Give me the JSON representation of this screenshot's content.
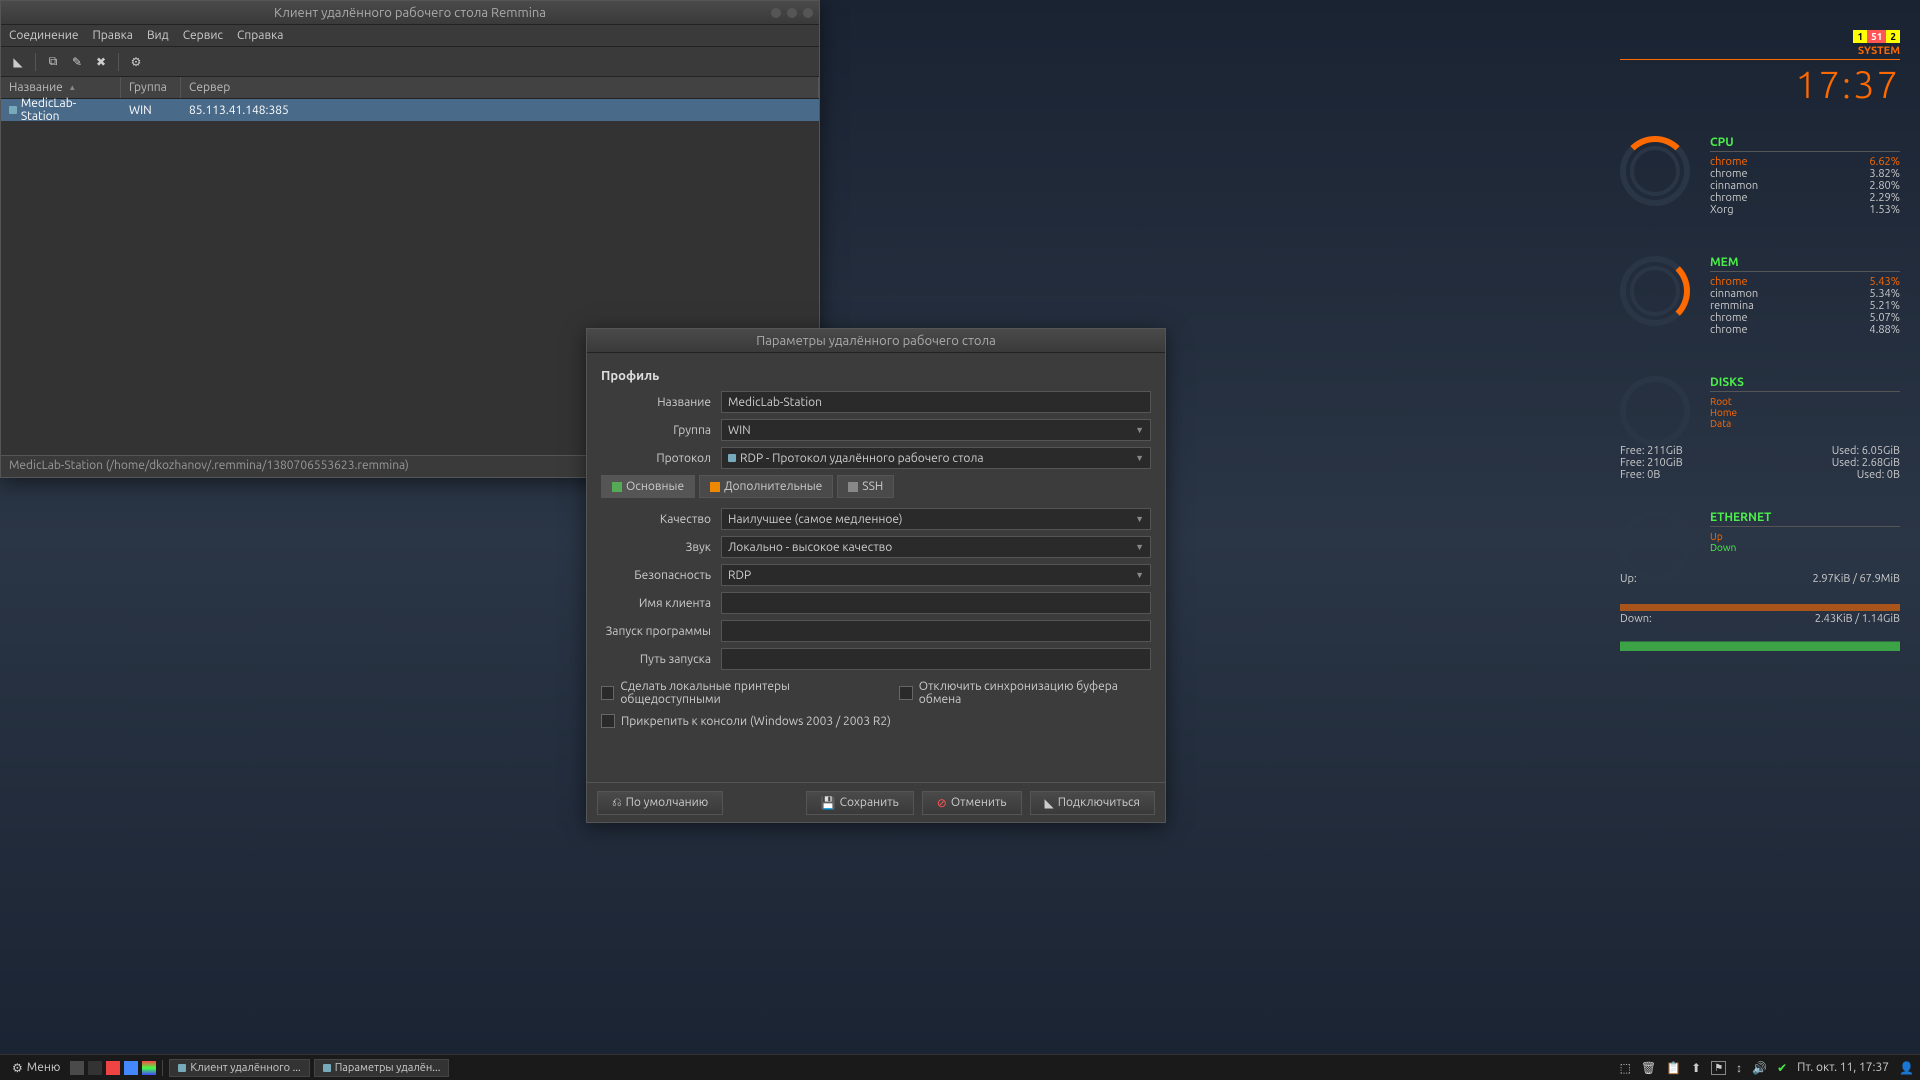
{
  "remmina_window": {
    "title": "Клиент удалённого рабочего стола Remmina",
    "menu": {
      "connection": "Соединение",
      "edit": "Правка",
      "view": "Вид",
      "service": "Сервис",
      "help": "Справка"
    },
    "columns": {
      "name": "Название",
      "group": "Группа",
      "server": "Сервер"
    },
    "rows": [
      {
        "name": "MedicLab-Station",
        "group": "WIN",
        "server": "85.113.41.148:385"
      }
    ],
    "status": "MedicLab-Station (/home/dkozhanov/.remmina/1380706553623.remmina)"
  },
  "dialog": {
    "title": "Параметры удалённого рабочего стола",
    "profile_label": "Профиль",
    "name_label": "Название",
    "name_value": "MedicLab-Station",
    "group_label": "Группа",
    "group_value": "WIN",
    "protocol_label": "Протокол",
    "protocol_value": "RDP - Протокол удалённого рабочего стола",
    "tabs": {
      "basic": "Основные",
      "advanced": "Дополнительные",
      "ssh": "SSH"
    },
    "quality_label": "Качество",
    "quality_value": "Наилучшее (самое медленное)",
    "sound_label": "Звук",
    "sound_value": "Локально - высокое качество",
    "security_label": "Безопасность",
    "security_value": "RDP",
    "client_label": "Имя клиента",
    "startup_prog_label": "Запуск программы",
    "startup_path_label": "Путь запуска",
    "chk_printers": "Сделать локальные принтеры общедоступными",
    "chk_clipboard": "Отключить синхронизацию буфера обмена",
    "chk_console": "Прикрепить к консоли (Windows 2003 / 2003 R2)",
    "btn_default": "По умолчанию",
    "btn_save": "Сохранить",
    "btn_cancel": "Отменить",
    "btn_connect": "Подключиться"
  },
  "conky": {
    "system_label": "SYSTEM",
    "badges": [
      "1",
      "51",
      "2"
    ],
    "time": "17:37",
    "cpu": {
      "title": "CPU",
      "procs": [
        {
          "name": "chrome",
          "pct": "6.62%",
          "hot": true
        },
        {
          "name": "chrome",
          "pct": "3.82%"
        },
        {
          "name": "cinnamon",
          "pct": "2.80%"
        },
        {
          "name": "chrome",
          "pct": "2.29%"
        },
        {
          "name": "Xorg",
          "pct": "1.53%"
        }
      ]
    },
    "mem": {
      "title": "MEM",
      "procs": [
        {
          "name": "chrome",
          "pct": "5.43%",
          "hot": true
        },
        {
          "name": "cinnamon",
          "pct": "5.34%"
        },
        {
          "name": "remmina",
          "pct": "5.21%"
        },
        {
          "name": "chrome",
          "pct": "5.07%"
        },
        {
          "name": "chrome",
          "pct": "4.88%"
        }
      ]
    },
    "disks": {
      "title": "DISKS",
      "labels": [
        "Root",
        "Home",
        "Data"
      ],
      "lines": [
        {
          "free": "Free: 211GiB",
          "used": "Used: 6.05GiB"
        },
        {
          "free": "Free: 210GiB",
          "used": "Used: 2.68GiB"
        },
        {
          "free": "Free: 0B",
          "used": "Used: 0B"
        }
      ]
    },
    "ethernet": {
      "title": "ETHERNET",
      "up_label": "Up",
      "down_label": "Down",
      "up_stat_label": "Up:",
      "up_stat": "2.97KiB / 67.9MiB",
      "down_stat_label": "Down:",
      "down_stat": "2.43KiB / 1.14GiB"
    }
  },
  "taskbar": {
    "menu": "Меню",
    "task1": "Клиент удалённого ...",
    "task2": "Параметры удалён...",
    "clock": "Пт. окт. 11, 17:37"
  }
}
